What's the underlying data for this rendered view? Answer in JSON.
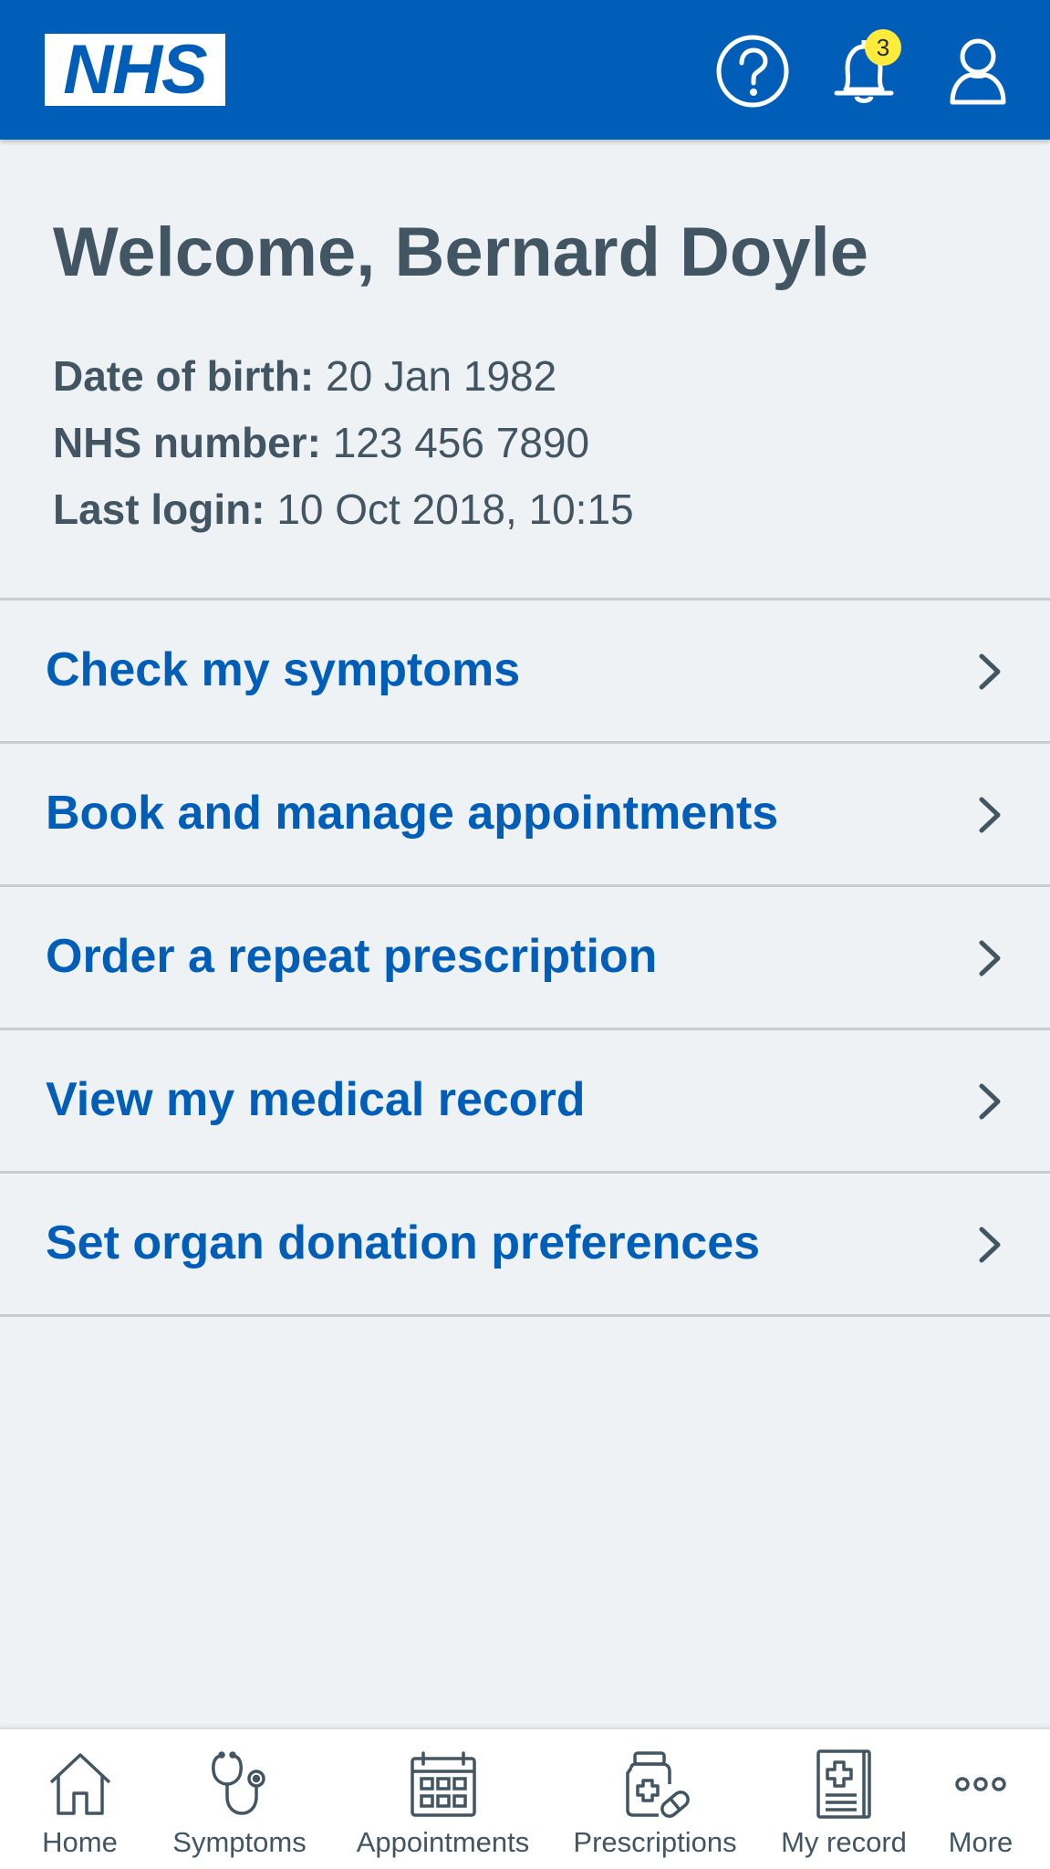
{
  "header": {
    "logo_text": "NHS",
    "notification_count": "3",
    "icons": [
      "help-icon",
      "bell-icon",
      "user-icon"
    ],
    "brand_color": "#005eb8",
    "badge_color": "#ffeb3b"
  },
  "welcome": {
    "title": "Welcome, Bernard Doyle",
    "dob_label": "Date of birth:",
    "dob_value": "20 Jan 1982",
    "nhs_label": "NHS number:",
    "nhs_value": "123 456 7890",
    "login_label": "Last login:",
    "login_value": "10 Oct 2018, 10:15"
  },
  "menu": {
    "items": [
      {
        "label": "Check my symptoms"
      },
      {
        "label": "Book and manage appointments"
      },
      {
        "label": "Order a repeat prescription"
      },
      {
        "label": "View my medical record"
      },
      {
        "label": "Set organ donation preferences"
      }
    ],
    "chevron_icon": "chevron-right-icon"
  },
  "tabs": [
    {
      "label": "Home",
      "icon": "home-icon"
    },
    {
      "label": "Symptoms",
      "icon": "stethoscope-icon"
    },
    {
      "label": "Appointments",
      "icon": "calendar-icon"
    },
    {
      "label": "Prescriptions",
      "icon": "prescription-icon"
    },
    {
      "label": "My record",
      "icon": "record-icon"
    },
    {
      "label": "More",
      "icon": "more-icon"
    }
  ],
  "colors": {
    "background": "#eef2f4",
    "text_secondary": "#425563",
    "link": "#005eb8",
    "divider": "#c6ccd0"
  }
}
